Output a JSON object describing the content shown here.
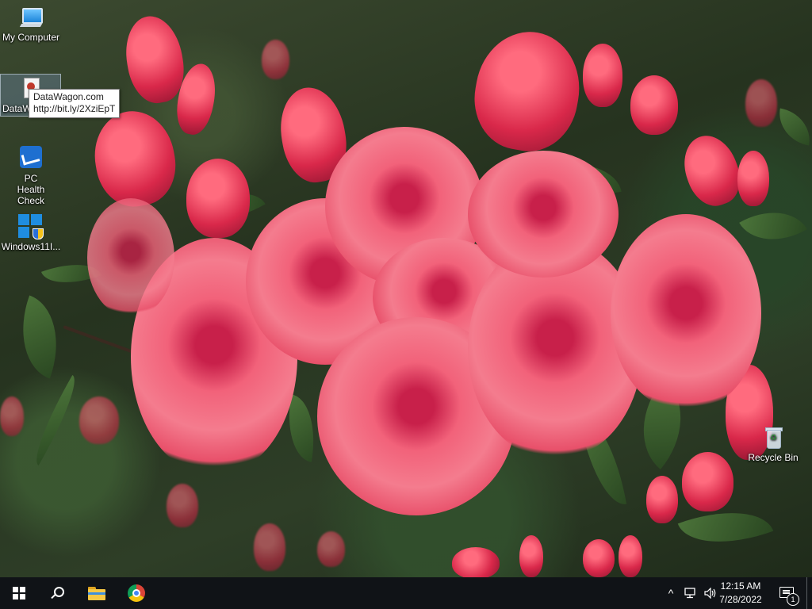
{
  "desktop": {
    "icons": [
      {
        "label": "My Computer",
        "icon": "computer-icon"
      },
      {
        "label": "DataW",
        "icon": "shortcut-page-icon"
      },
      {
        "label": "PC Health Check",
        "icon": "health-check-icon"
      },
      {
        "label": "Windows11I...",
        "icon": "windows-installer-icon"
      },
      {
        "label": "Recycle Bin",
        "icon": "recycle-bin-icon"
      }
    ],
    "tooltip": {
      "title": "DataWagon.com",
      "url": "http://bit.ly/2XziEpT"
    },
    "wallpaper": "pink azalea flowers",
    "accent_color": "#1f8de0"
  },
  "taskbar": {
    "start": {
      "icon": "windows-logo-icon"
    },
    "search": {
      "icon": "search-icon"
    },
    "pinned": [
      {
        "name": "File Explorer",
        "icon": "folder-icon"
      },
      {
        "name": "Google Chrome",
        "icon": "chrome-icon"
      }
    ],
    "tray": {
      "chevron": "^",
      "network_icon": "network-icon",
      "volume_icon": "speaker-icon"
    },
    "clock": {
      "time": "12:15 AM",
      "date": "7/28/2022"
    },
    "notifications": {
      "count": "1",
      "icon": "action-center-icon"
    }
  }
}
